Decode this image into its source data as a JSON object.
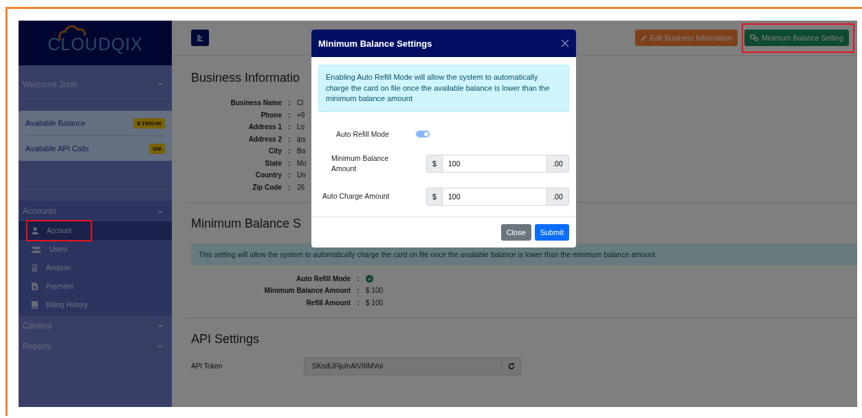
{
  "sidebar": {
    "logo": "CLOUDQIX",
    "welcome": {
      "label": "Welcome John",
      "expanded": false
    },
    "stats": [
      {
        "label": "Available Balance",
        "value": "$ 1500.00"
      },
      {
        "label": "Available API Calls",
        "value": "100"
      }
    ],
    "sections": [
      {
        "label": "Accounts",
        "expanded": true,
        "items": [
          {
            "label": "Account",
            "kind": "user",
            "selected": true,
            "highlighted": true
          },
          {
            "label": "Users",
            "kind": "users",
            "selected": false,
            "highlighted": false
          },
          {
            "label": "Amazon",
            "kind": "amazon",
            "selected": false,
            "highlighted": false
          },
          {
            "label": "Payment",
            "kind": "invoice",
            "selected": false,
            "highlighted": false
          },
          {
            "label": "Billing History",
            "kind": "book",
            "selected": false,
            "highlighted": false
          }
        ]
      },
      {
        "label": "Carriers",
        "expanded": false
      },
      {
        "label": "Reports",
        "expanded": false
      }
    ]
  },
  "topbar": {
    "buttons": [
      {
        "label": "Edit Business Information",
        "kind": "edit",
        "highlighted": false
      },
      {
        "label": "Minimum Balance Setting",
        "kind": "settings",
        "highlighted": true
      }
    ]
  },
  "business_info": {
    "heading": "Business Informatio",
    "fields": [
      {
        "label": "Business Name",
        "colon": ":",
        "value": "Cl"
      },
      {
        "label": "Phone",
        "colon": ":",
        "value": "+9"
      },
      {
        "label": "Address 1",
        "colon": ":",
        "value": "Lo"
      },
      {
        "label": "Address 2",
        "colon": ":",
        "value": "ips"
      },
      {
        "label": "City",
        "colon": ":",
        "value": "Ba"
      },
      {
        "label": "State",
        "colon": ":",
        "value": "Mo"
      },
      {
        "label": "Country",
        "colon": ":",
        "value": "Un"
      },
      {
        "label": "Zip Code",
        "colon": ":",
        "value": "26"
      }
    ]
  },
  "min_balance": {
    "heading": "Minimum Balance S",
    "alert": "This setting will allow the system to automatically charge the card on file once the available balance is lower than the minimum balance amount",
    "fields": [
      {
        "label": "Auto Refill Mode",
        "colon": ":",
        "kind": "check",
        "checked": true
      },
      {
        "label": "Minimum Balance Amount",
        "colon": ":",
        "kind": "text",
        "value": "$ 100"
      },
      {
        "label": "Refill Amount",
        "colon": ":",
        "kind": "text",
        "value": "$ 100"
      }
    ]
  },
  "api": {
    "heading": "API Settings",
    "label": "API Token",
    "token": "SKodUFljuInAtV9IMVoI"
  },
  "modal": {
    "title": "Minimum Balance Settings",
    "alert": "Enabling Auto Refill Mode will allow the system to automatically charge the card on file once the available balance is lower than the minimum balance amount",
    "fields": [
      {
        "label": "Auto Refill Mode",
        "kind": "toggle",
        "on": true
      },
      {
        "label": "Minimum Balance Amount",
        "kind": "amount",
        "prefix": "$",
        "value": "100",
        "suffix": ".00"
      },
      {
        "label": "Auto Charge Amount",
        "kind": "amount",
        "prefix": "$",
        "value": "100",
        "suffix": ".00"
      }
    ],
    "buttons": [
      {
        "label": "Close",
        "kind": "secondary"
      },
      {
        "label": "Submit",
        "kind": "primary"
      }
    ]
  }
}
